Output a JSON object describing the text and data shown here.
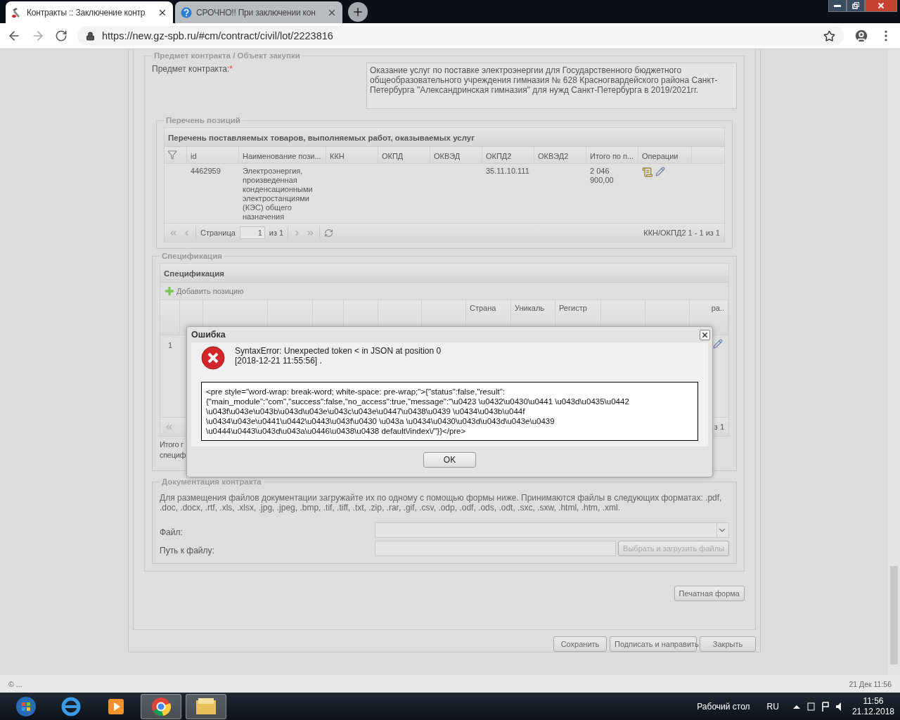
{
  "browser": {
    "tabs": [
      {
        "title": "Контракты :: Заключение контр",
        "selected": true
      },
      {
        "title": "СРОЧНО!! При заключении кон",
        "selected": false
      }
    ],
    "url": "https://new.gz-spb.ru/#cm/contract/civil/lot/2223816"
  },
  "subject": {
    "legend": "Предмет контракта / Объект закупки",
    "label": "Предмет контракта:",
    "required_mark": "*",
    "value": "Оказание услуг по поставке электроэнергии для Государственного бюджетного общеобразовательного учреждения гимназия № 628 Красногвардейского района Санкт-Петербурга \"Александринская гимназия\" для нужд Санкт-Петербурга в 2019/2021гг."
  },
  "positions": {
    "legend": "Перечень позиций",
    "grid_title": "Перечень поставляемых товаров, выполняемых работ, оказываемых услуг",
    "columns": [
      "id",
      "Наименование пози...",
      "ККН",
      "ОКПД",
      "ОКВЭД",
      "ОКПД2",
      "ОКВЭД2",
      "Итого по п...",
      "Операции"
    ],
    "rows": [
      {
        "cells": [
          "4462959",
          "Электроэнергия, произведенная конденсационными электростанциями (КЭС) общего назначения",
          "",
          "",
          "",
          "35.11.10.111",
          "",
          "2 046 900,00"
        ]
      }
    ],
    "pager": {
      "page_label": "Страница",
      "page": "1",
      "of": "из 1",
      "summary": "ККН/ОКПД2 1 - 1 из 1"
    }
  },
  "specification": {
    "legend": "Спецификация",
    "grid_title": "Спецификация",
    "add_button": "Добавить позицию",
    "columns": [
      "",
      "",
      "",
      "",
      "",
      "",
      "",
      "",
      "Страна",
      "Уникаль",
      "Регистр",
      "",
      "",
      "ра.."
    ],
    "row_cells": [
      "1"
    ],
    "pager_tail": "з 1",
    "total_lines": [
      "Итого г",
      "специф"
    ]
  },
  "documents": {
    "legend": "Документация контракта",
    "hint": "Для размещения файлов документации загружайте их по одному с помощью формы ниже. Принимаются файлы в следующих форматах: .pdf, .doc, .docx, .rtf, .xls, .xlsx, .jpg, .jpeg, .bmp, .tif, .tiff, .txt, .zip, .rar, .gif, .csv, .odp, .odf, .ods, .odt, .sxc, .sxw, .html, .htm, .xml.",
    "file_label": "Файл:",
    "path_label": "Путь к файлу:",
    "upload_button": "Выбрать и загрузить файлы"
  },
  "print_button": "Печатная форма",
  "footer_buttons": [
    "Сохранить",
    "Подписать и направить",
    "Закрыть"
  ],
  "status_bar": {
    "left": "© ...",
    "right": "21 Дек 11:56"
  },
  "dialog": {
    "title": "Ошибка",
    "message": "SyntaxError: Unexpected token < in JSON at position 0",
    "timestamp": "[2018-12-21 11:55:56] .",
    "details": "<pre style=\"word-wrap: break-word; white-space: pre-wrap;\">{\"status\":false,\"result\":\n{\"main_module\":\"com\",\"success\":false,\"no_access\":true,\"message\":\"\\u0423 \\u0432\\u0430\\u0441 \\u043d\\u0435\\u0442\n\\u043f\\u043e\\u043b\\u043d\\u043e\\u043c\\u043e\\u0447\\u0438\\u0439 \\u0434\\u043b\\u044f\n\\u0434\\u043e\\u0441\\u0442\\u0443\\u043f\\u0430 \\u043a \\u0434\\u0430\\u043d\\u043d\\u043e\\u0439\n\\u0444\\u0443\\u043d\\u043a\\u0446\\u0438\\u0438 default\\/index\\/\"}}</pre>",
    "button": "OK"
  },
  "taskbar": {
    "desktop_label": "Рабочий стол",
    "lang": "RU",
    "time": "11:56",
    "date": "21.12.2018"
  }
}
